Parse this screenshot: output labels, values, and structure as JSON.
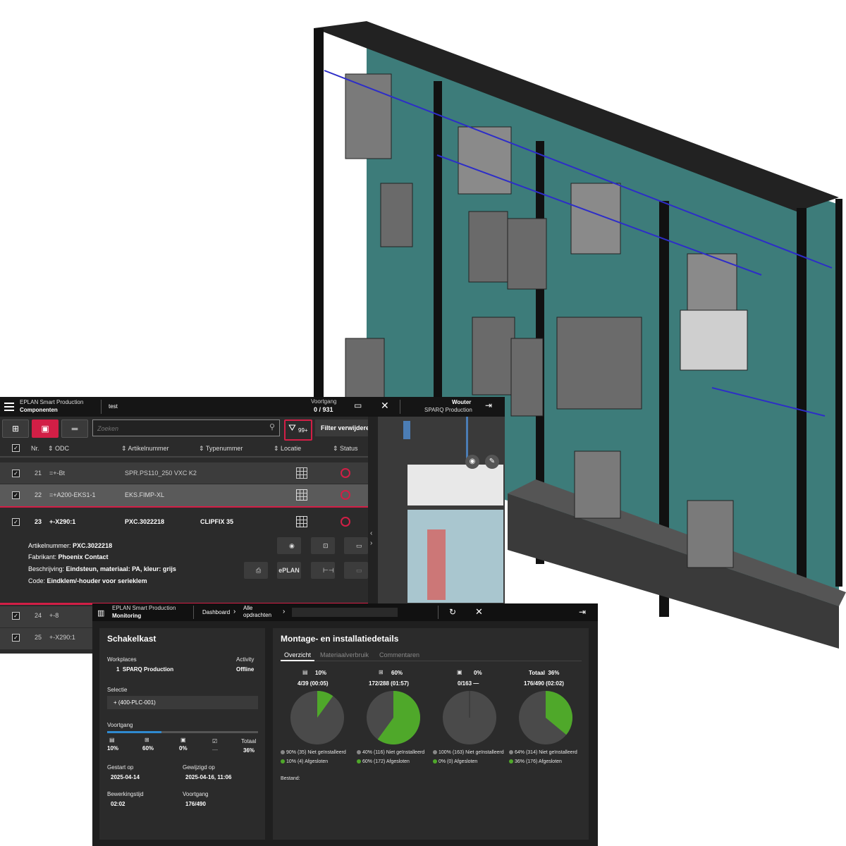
{
  "components": {
    "app_name": "EPLAN Smart Production",
    "section": "Componenten",
    "project": "test",
    "progress_label": "Voortgang",
    "progress_value": "0 / 931",
    "user": "Wouter",
    "org": "SPARQ Production",
    "search_placeholder": "Zoeken",
    "filter_count": "99+",
    "clear_filter": "Filter verwijderen",
    "columns": [
      "Nr.",
      "ODC",
      "Artikelnummer",
      "Typenummer",
      "Locatie",
      "Status"
    ],
    "rows": [
      {
        "nr": "21",
        "odc": "=+-Bt",
        "artikel": "SPR.PS110_250 VXC K2",
        "type": ""
      },
      {
        "nr": "22",
        "odc": "=+A200-EKS1-1",
        "artikel": "EKS.FIMP-XL",
        "type": ""
      },
      {
        "nr": "23",
        "odc": "+-X290:1",
        "artikel": "PXC.3022218",
        "type": "CLIPFIX 35"
      },
      {
        "nr": "24",
        "odc": "+-8",
        "artikel": "",
        "type": ""
      },
      {
        "nr": "25",
        "odc": "+-X290:1",
        "artikel": "",
        "type": ""
      }
    ],
    "details": {
      "artikel_label": "Artikelnummer:",
      "artikel_value": "PXC.3022218",
      "fabrikant_label": "Fabrikant:",
      "fabrikant_value": "Phoenix Contact",
      "beschrijving_label": "Beschrijving:",
      "beschrijving_value": "Eindsteun, materiaal: PA, kleur: grijs",
      "code_label": "Code:",
      "code_value": "Eindklem/-houder voor serieklem",
      "eplan_btn": "ePLAN"
    }
  },
  "monitoring": {
    "app_name": "EPLAN Smart Production",
    "section": "Monitoring",
    "crumb_dashboard": "Dashboard",
    "crumb_all": "Alle opdrachten",
    "left": {
      "title": "Schakelkast",
      "workplaces_label": "Workplaces",
      "activity_label": "Activity",
      "workplace": "1  SPARQ Production",
      "activity": "Offline",
      "selectie_label": "Selectie",
      "selectie_value": "+ (400-PLC-001)",
      "voortgang_label": "Voortgang",
      "progress_fraction": 0.36,
      "mini": [
        {
          "icon": "cabinet-icon",
          "value": "10%"
        },
        {
          "icon": "terminal-icon",
          "value": "60%"
        },
        {
          "icon": "device-icon",
          "value": "0%"
        },
        {
          "icon": "check-icon",
          "value": "—"
        }
      ],
      "totaal_label": "Totaal",
      "totaal_value": "36%",
      "gestart_label": "Gestart op",
      "gestart_value": "2025-04-14",
      "gewijzigd_label": "Gewijzigd op",
      "gewijzigd_value": "2025-04-16, 11:06",
      "bewerkingstijd_label": "Bewerkingstijd",
      "bewerkingstijd_value": "02:02",
      "voortgang2_label": "Voortgang",
      "voortgang2_value": "176/490"
    },
    "right": {
      "title": "Montage- en installatiedetails",
      "tabs": [
        "Overzicht",
        "Materiaalverbruik",
        "Commentaren"
      ],
      "bestand_label": "Bestand:",
      "pies": [
        {
          "label": "10%",
          "counts": "4/39 (00:05)",
          "fraction": 0.1,
          "leg1": "90% (35) Niet geïnstalleerd",
          "leg2": "10% (4) Afgesloten"
        },
        {
          "label": "60%",
          "counts": "172/288 (01:57)",
          "fraction": 0.6,
          "leg1": "40% (116) Niet geïnstalleerd",
          "leg2": "60% (172) Afgesloten"
        },
        {
          "label": "0%",
          "counts": "0/163 —",
          "fraction": 0.0,
          "leg1": "100% (163) Niet geïnstalleerd",
          "leg2": "0% (0) Afgesloten"
        },
        {
          "label": "Totaal  36%",
          "counts": "176/490 (02:02)",
          "fraction": 0.36,
          "leg1": "64% (314) Niet geïnstalleerd",
          "leg2": "36% (176) Afgesloten"
        }
      ]
    }
  },
  "colors": {
    "accent": "#d21f46",
    "green": "#4fa82a",
    "pie_grey": "#4a4a4a",
    "teal": "#3d7c7a"
  }
}
